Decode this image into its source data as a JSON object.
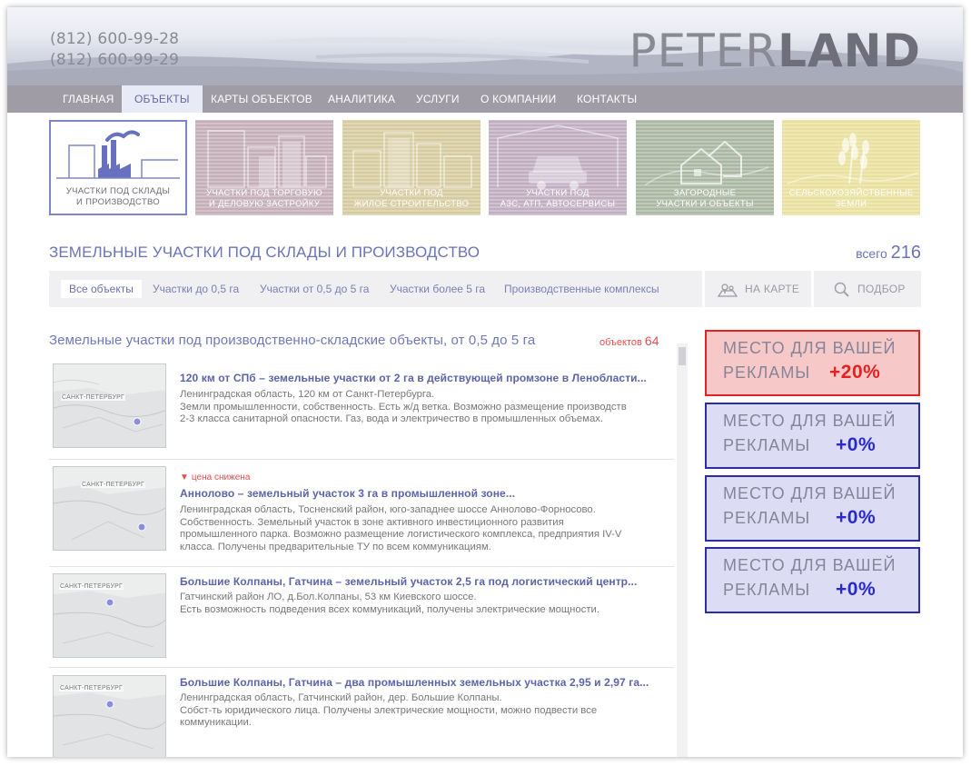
{
  "header": {
    "phones": [
      "(812) 600-99-28",
      "(812) 600-99-29"
    ],
    "logo_light": "PETER",
    "logo_bold": "LAND"
  },
  "nav": {
    "items": [
      {
        "label": "Главная"
      },
      {
        "label": "Объекты",
        "active": true
      },
      {
        "label": "Карты объектов"
      },
      {
        "label": "Аналитика"
      },
      {
        "label": "Услуги"
      },
      {
        "label": "О компании"
      },
      {
        "label": "Контакты"
      }
    ]
  },
  "categories": [
    {
      "label": "Участки под склады\nи производство",
      "icon": "factory-icon",
      "color": "#ffffff",
      "selected": true
    },
    {
      "label": "Участки под торговую\nи деловую застройку",
      "icon": "office-buildings-icon",
      "color": "#c4aeb8"
    },
    {
      "label": "Участки под\nжилое строительство",
      "icon": "residential-buildings-icon",
      "color": "#d6ca9f"
    },
    {
      "label": "Участки под\nАЗС, АТП, автосервисы",
      "icon": "car-icon",
      "color": "#c0aec0"
    },
    {
      "label": "Загородные\nучастки и объекты",
      "icon": "houses-icon",
      "color": "#aab7a2"
    },
    {
      "label": "Сельскохозяйственные\nземли",
      "icon": "wheat-icon",
      "color": "#e8e09c"
    }
  ],
  "page": {
    "title": "Земельные участки под склады и производство",
    "total_label": "всего",
    "total": "216"
  },
  "filters": {
    "items": [
      {
        "label": "Все объекты",
        "active": true
      },
      {
        "label": "Участки до 0,5 га"
      },
      {
        "label": "Участки от 0,5 до 5 га"
      },
      {
        "label": "Участки более 5 га"
      },
      {
        "label": "Производственные комплексы"
      }
    ],
    "map_button": "На карте",
    "search_button": "Подбор"
  },
  "section": {
    "title": "Земельные участки под производственно-складские объекты, от 0,5 до 5 га",
    "count_label": "объектов",
    "count": "64"
  },
  "listings": [
    {
      "title": "120 км от СПб – земельные участки от 2 га в действующей промзоне в Ленобласти...",
      "description": "Ленинградская область, 120 км от Санкт-Петербурга.\nЗемли промышленности, собственность. Есть ж/д ветка. Возможно размещение производств\n2-3 класса санитарной опасности. Газ, вода и электричество в промышленных объемах.",
      "map_label": "САНКТ-ПЕТЕРБУРГ"
    },
    {
      "badge": "цена снижена",
      "title": "Аннолово – земельный участок 3 га в промышленной зоне...",
      "description": "Ленинградская область, Тосненский район, юго-западнее шоссе Аннолово-Форносово.\nСобственность. Земельный участок в зоне активного инвестиционного развития\nпромышленного парка. Возможно размещение логистического комплекса, предприятия IV-V\nкласса. Получены предварительные ТУ по всем коммуникациям.",
      "map_label": "САНКТ-ПЕТЕРБУРГ"
    },
    {
      "title": "Большие Колпаны, Гатчина – земельный участок 2,5 га под логистический центр...",
      "description": "Гатчинский район ЛО, д.Бол.Колпаны, 53 км Киевского шоссе.\nЕсть возможность подведения всех коммуникаций, получены электрические мощности.",
      "map_label": "САНКТ-ПЕТЕРБУРГ"
    },
    {
      "title": "Большие Колпаны, Гатчина – два промышленных земельных участка 2,95 и 2,97 га...",
      "description": "Ленинградская область, Гатчинский район, дер. Большие Колпаны.\nСобст-ть юридического лица. Получены электрические мощности, можно подвести все\nкоммуникации.",
      "map_label": "САНКТ-ПЕТЕРБУРГ"
    }
  ],
  "ads": [
    {
      "line1": "Место для вашей",
      "line2": "рекламы",
      "percent": "+20%",
      "color": "#e42222"
    },
    {
      "line1": "Место для вашей",
      "line2": "рекламы",
      "percent": "+0%",
      "color": "#2a2ac8"
    },
    {
      "line1": "Место для вашей",
      "line2": "рекламы",
      "percent": "+0%",
      "color": "#2a2ac8"
    },
    {
      "line1": "Место для вашей",
      "line2": "рекламы",
      "percent": "+0%",
      "color": "#2a2ac8"
    }
  ]
}
